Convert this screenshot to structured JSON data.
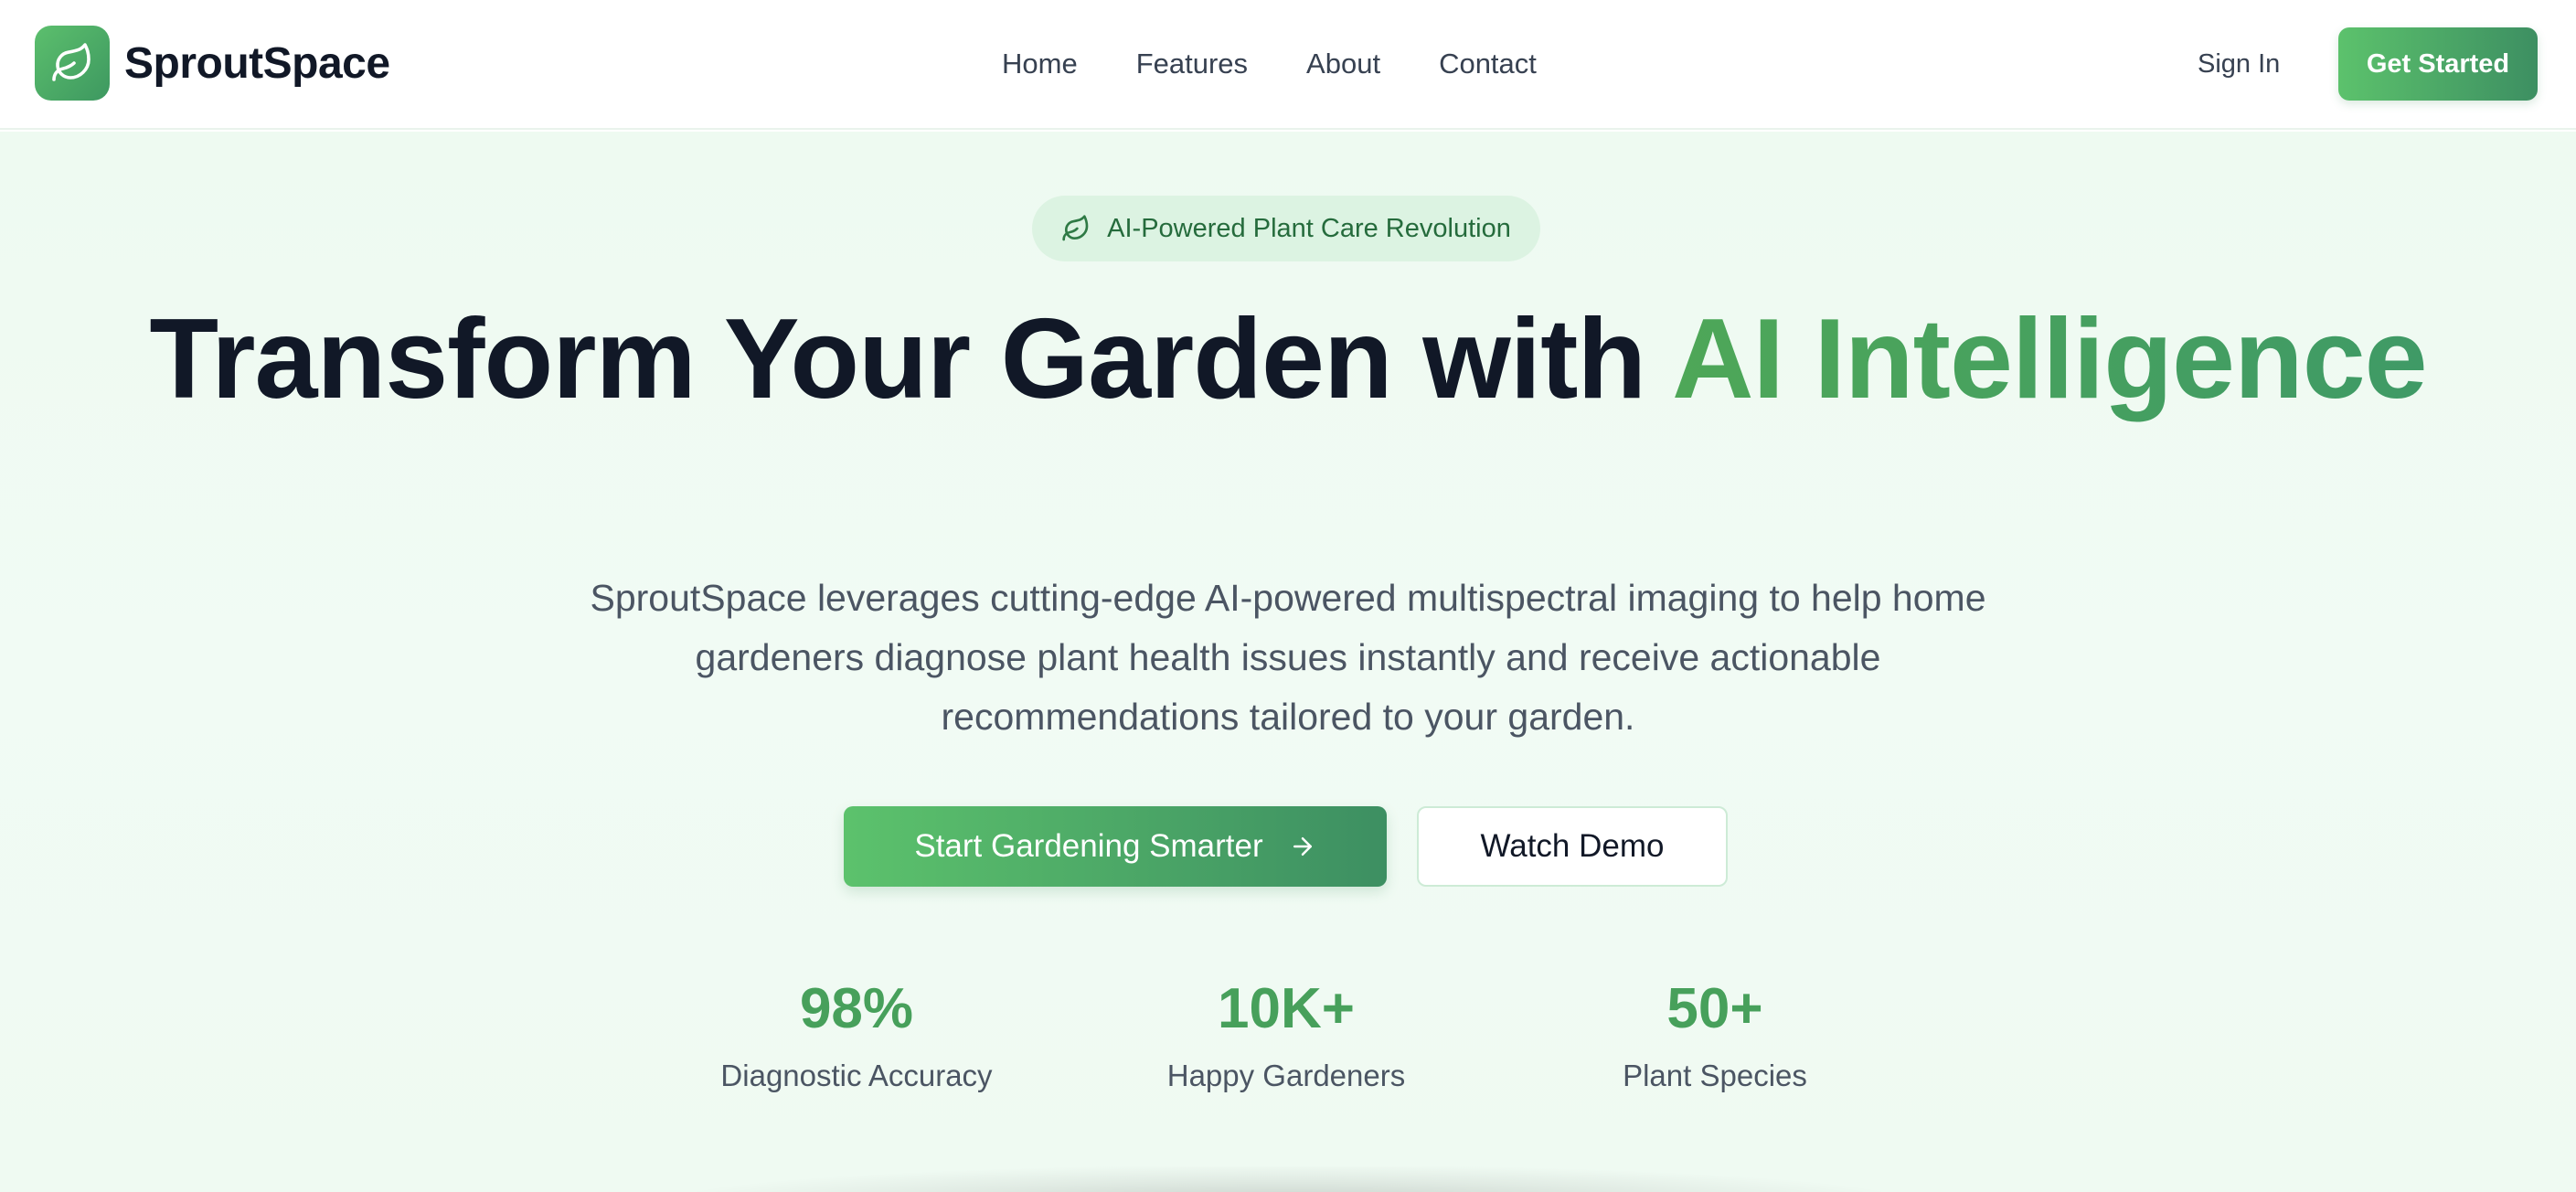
{
  "brand": {
    "name": "SproutSpace",
    "logo_icon": "leaf-icon",
    "color_accent": "#4ea758"
  },
  "nav": {
    "items": [
      {
        "label": "Home"
      },
      {
        "label": "Features"
      },
      {
        "label": "About"
      },
      {
        "label": "Contact"
      }
    ],
    "sign_in_label": "Sign In",
    "get_started_label": "Get Started"
  },
  "hero": {
    "badge_icon": "leaf-icon",
    "badge_text": "AI-Powered Plant Care Revolution",
    "headline_main": "Transform Your Garden with ",
    "headline_accent": "AI Intelligence",
    "subtext": "SproutSpace leverages cutting-edge AI-powered multispectral imaging to help home gardeners diagnose plant health issues instantly and receive actionable recommendations tailored to your garden.",
    "cta_primary_label": "Start Gardening Smarter",
    "cta_primary_icon": "arrow-right-icon",
    "cta_secondary_label": "Watch Demo"
  },
  "stats": [
    {
      "value": "98%",
      "label": "Diagnostic Accuracy"
    },
    {
      "value": "10K+",
      "label": "Happy Gardeners"
    },
    {
      "value": "50+",
      "label": "Plant Species"
    }
  ]
}
